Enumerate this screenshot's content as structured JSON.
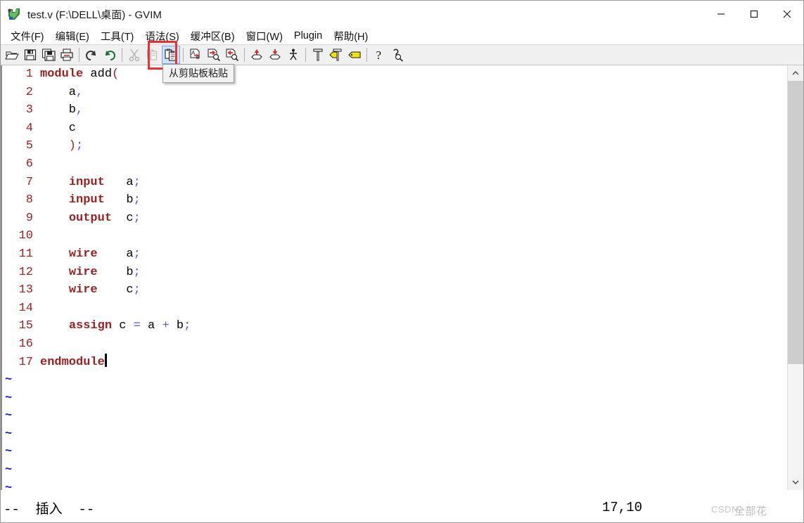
{
  "window": {
    "title": "test.v (F:\\DELL\\桌面) - GVIM",
    "app_icon": "gvim-logo-icon",
    "controls": {
      "minimize": "minimize-icon",
      "maximize": "maximize-icon",
      "close": "close-icon"
    }
  },
  "menubar": {
    "items": [
      {
        "label": "文件(F)",
        "name": "menu-file"
      },
      {
        "label": "编辑(E)",
        "name": "menu-edit"
      },
      {
        "label": "工具(T)",
        "name": "menu-tools"
      },
      {
        "label": "语法(S)",
        "name": "menu-syntax"
      },
      {
        "label": "缓冲区(B)",
        "name": "menu-buffers"
      },
      {
        "label": "窗口(W)",
        "name": "menu-window"
      },
      {
        "label": "Plugin",
        "name": "menu-plugin"
      },
      {
        "label": "帮助(H)",
        "name": "menu-help"
      }
    ]
  },
  "toolbar": {
    "active_button": "paste-button",
    "tooltip": "从剪贴板粘贴",
    "buttons": [
      {
        "icon": "open-file-icon",
        "disabled": false
      },
      {
        "icon": "save-icon",
        "disabled": false
      },
      {
        "icon": "save-all-icon",
        "disabled": false
      },
      {
        "icon": "print-icon",
        "disabled": false
      },
      {
        "sep": true
      },
      {
        "icon": "undo-icon",
        "disabled": false
      },
      {
        "icon": "redo-icon",
        "disabled": false
      },
      {
        "sep": true
      },
      {
        "icon": "cut-icon",
        "disabled": true
      },
      {
        "icon": "copy-icon",
        "disabled": true
      },
      {
        "icon": "paste-icon",
        "disabled": false,
        "active": true
      },
      {
        "sep": true
      },
      {
        "icon": "find-replace-icon",
        "disabled": false
      },
      {
        "icon": "find-next-icon",
        "disabled": false
      },
      {
        "icon": "find-prev-icon",
        "disabled": false
      },
      {
        "sep": true
      },
      {
        "icon": "load-session-icon",
        "disabled": false
      },
      {
        "icon": "save-session-icon",
        "disabled": false
      },
      {
        "icon": "run-script-icon",
        "disabled": false
      },
      {
        "sep": true
      },
      {
        "icon": "make-icon",
        "disabled": false
      },
      {
        "icon": "build-tags-icon",
        "disabled": false
      },
      {
        "icon": "jump-tag-icon",
        "disabled": false
      },
      {
        "sep": true
      },
      {
        "icon": "help-icon",
        "disabled": false
      },
      {
        "icon": "find-help-icon",
        "disabled": false
      }
    ]
  },
  "editor": {
    "filler_char": "~",
    "filler_count": 7,
    "cursor_line": 17,
    "lines": [
      {
        "num": "1",
        "tokens": [
          {
            "t": "module",
            "c": "kw"
          },
          {
            "t": " add",
            "c": ""
          },
          {
            "t": "(",
            "c": "pn"
          }
        ]
      },
      {
        "num": "2",
        "tokens": [
          {
            "t": "    a",
            "c": ""
          },
          {
            "t": ",",
            "c": "op"
          }
        ]
      },
      {
        "num": "3",
        "tokens": [
          {
            "t": "    b",
            "c": ""
          },
          {
            "t": ",",
            "c": "op"
          }
        ]
      },
      {
        "num": "4",
        "tokens": [
          {
            "t": "    c",
            "c": ""
          }
        ]
      },
      {
        "num": "5",
        "tokens": [
          {
            "t": "    )",
            "c": "pn"
          },
          {
            "t": ";",
            "c": "op"
          }
        ]
      },
      {
        "num": "6",
        "tokens": [
          {
            "t": "",
            "c": ""
          }
        ]
      },
      {
        "num": "7",
        "tokens": [
          {
            "t": "    ",
            "c": ""
          },
          {
            "t": "input",
            "c": "kw"
          },
          {
            "t": "   a",
            "c": ""
          },
          {
            "t": ";",
            "c": "op"
          }
        ]
      },
      {
        "num": "8",
        "tokens": [
          {
            "t": "    ",
            "c": ""
          },
          {
            "t": "input",
            "c": "kw"
          },
          {
            "t": "   b",
            "c": ""
          },
          {
            "t": ";",
            "c": "op"
          }
        ]
      },
      {
        "num": "9",
        "tokens": [
          {
            "t": "    ",
            "c": ""
          },
          {
            "t": "output",
            "c": "kw"
          },
          {
            "t": "  c",
            "c": ""
          },
          {
            "t": ";",
            "c": "op"
          }
        ]
      },
      {
        "num": "10",
        "tokens": [
          {
            "t": "",
            "c": ""
          }
        ]
      },
      {
        "num": "11",
        "tokens": [
          {
            "t": "    ",
            "c": ""
          },
          {
            "t": "wire",
            "c": "kw"
          },
          {
            "t": "    a",
            "c": ""
          },
          {
            "t": ";",
            "c": "op"
          }
        ]
      },
      {
        "num": "12",
        "tokens": [
          {
            "t": "    ",
            "c": ""
          },
          {
            "t": "wire",
            "c": "kw"
          },
          {
            "t": "    b",
            "c": ""
          },
          {
            "t": ";",
            "c": "op"
          }
        ]
      },
      {
        "num": "13",
        "tokens": [
          {
            "t": "    ",
            "c": ""
          },
          {
            "t": "wire",
            "c": "kw"
          },
          {
            "t": "    c",
            "c": ""
          },
          {
            "t": ";",
            "c": "op"
          }
        ]
      },
      {
        "num": "14",
        "tokens": [
          {
            "t": "",
            "c": ""
          }
        ]
      },
      {
        "num": "15",
        "tokens": [
          {
            "t": "    ",
            "c": ""
          },
          {
            "t": "assign",
            "c": "kw"
          },
          {
            "t": " c ",
            "c": ""
          },
          {
            "t": "=",
            "c": "op"
          },
          {
            "t": " a ",
            "c": ""
          },
          {
            "t": "+",
            "c": "op"
          },
          {
            "t": " b",
            "c": ""
          },
          {
            "t": ";",
            "c": "op"
          }
        ]
      },
      {
        "num": "16",
        "tokens": [
          {
            "t": "",
            "c": ""
          }
        ]
      },
      {
        "num": "17",
        "tokens": [
          {
            "t": "endmodule",
            "c": "kw"
          }
        ],
        "cursor": true
      }
    ]
  },
  "scrollbar": {
    "up_arrow": "chevron-up-icon",
    "down_arrow": "chevron-down-icon"
  },
  "statusbar": {
    "mode": "--  插入  --",
    "position": "17,10"
  },
  "watermark": {
    "text": "CSDN",
    "text2": "全部花"
  },
  "colors": {
    "keyword": "#9b2020",
    "operator": "#5a57d0",
    "linenumber": "#9b2020",
    "tilde": "#1414d6",
    "accent_box": "#f03030",
    "toolbar_bg": "#f0f0f0",
    "active_button_bg": "#cde3f7"
  }
}
